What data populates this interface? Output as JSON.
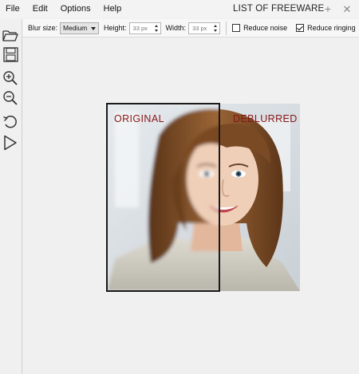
{
  "menu": {
    "items": [
      "File",
      "Edit",
      "Options",
      "Help"
    ]
  },
  "window": {
    "title": "LIST OF FREEWARE",
    "new_tab_icon": "plus-icon",
    "close_icon": "close-icon"
  },
  "toolbar": {
    "blur_size_label": "Blur size:",
    "blur_size_value": "Medium",
    "height_label": "Height:",
    "height_value": "33 px",
    "width_label": "Width:",
    "width_value": "33 px",
    "reduce_noise_label": "Reduce noise",
    "reduce_noise_checked": false,
    "reduce_ringing_label": "Reduce ringing",
    "reduce_ringing_checked": true
  },
  "sidebar": {
    "tools": [
      "open-folder-icon",
      "save-icon",
      "zoom-in-icon",
      "zoom-out-icon",
      "undo-icon",
      "play-icon"
    ]
  },
  "preview": {
    "left_label": "ORIGINAL",
    "right_label": "DEBLURRED"
  },
  "colors": {
    "label_red": "#8a1515",
    "hair": "#7a4a24",
    "skin": "#efcfb8"
  }
}
